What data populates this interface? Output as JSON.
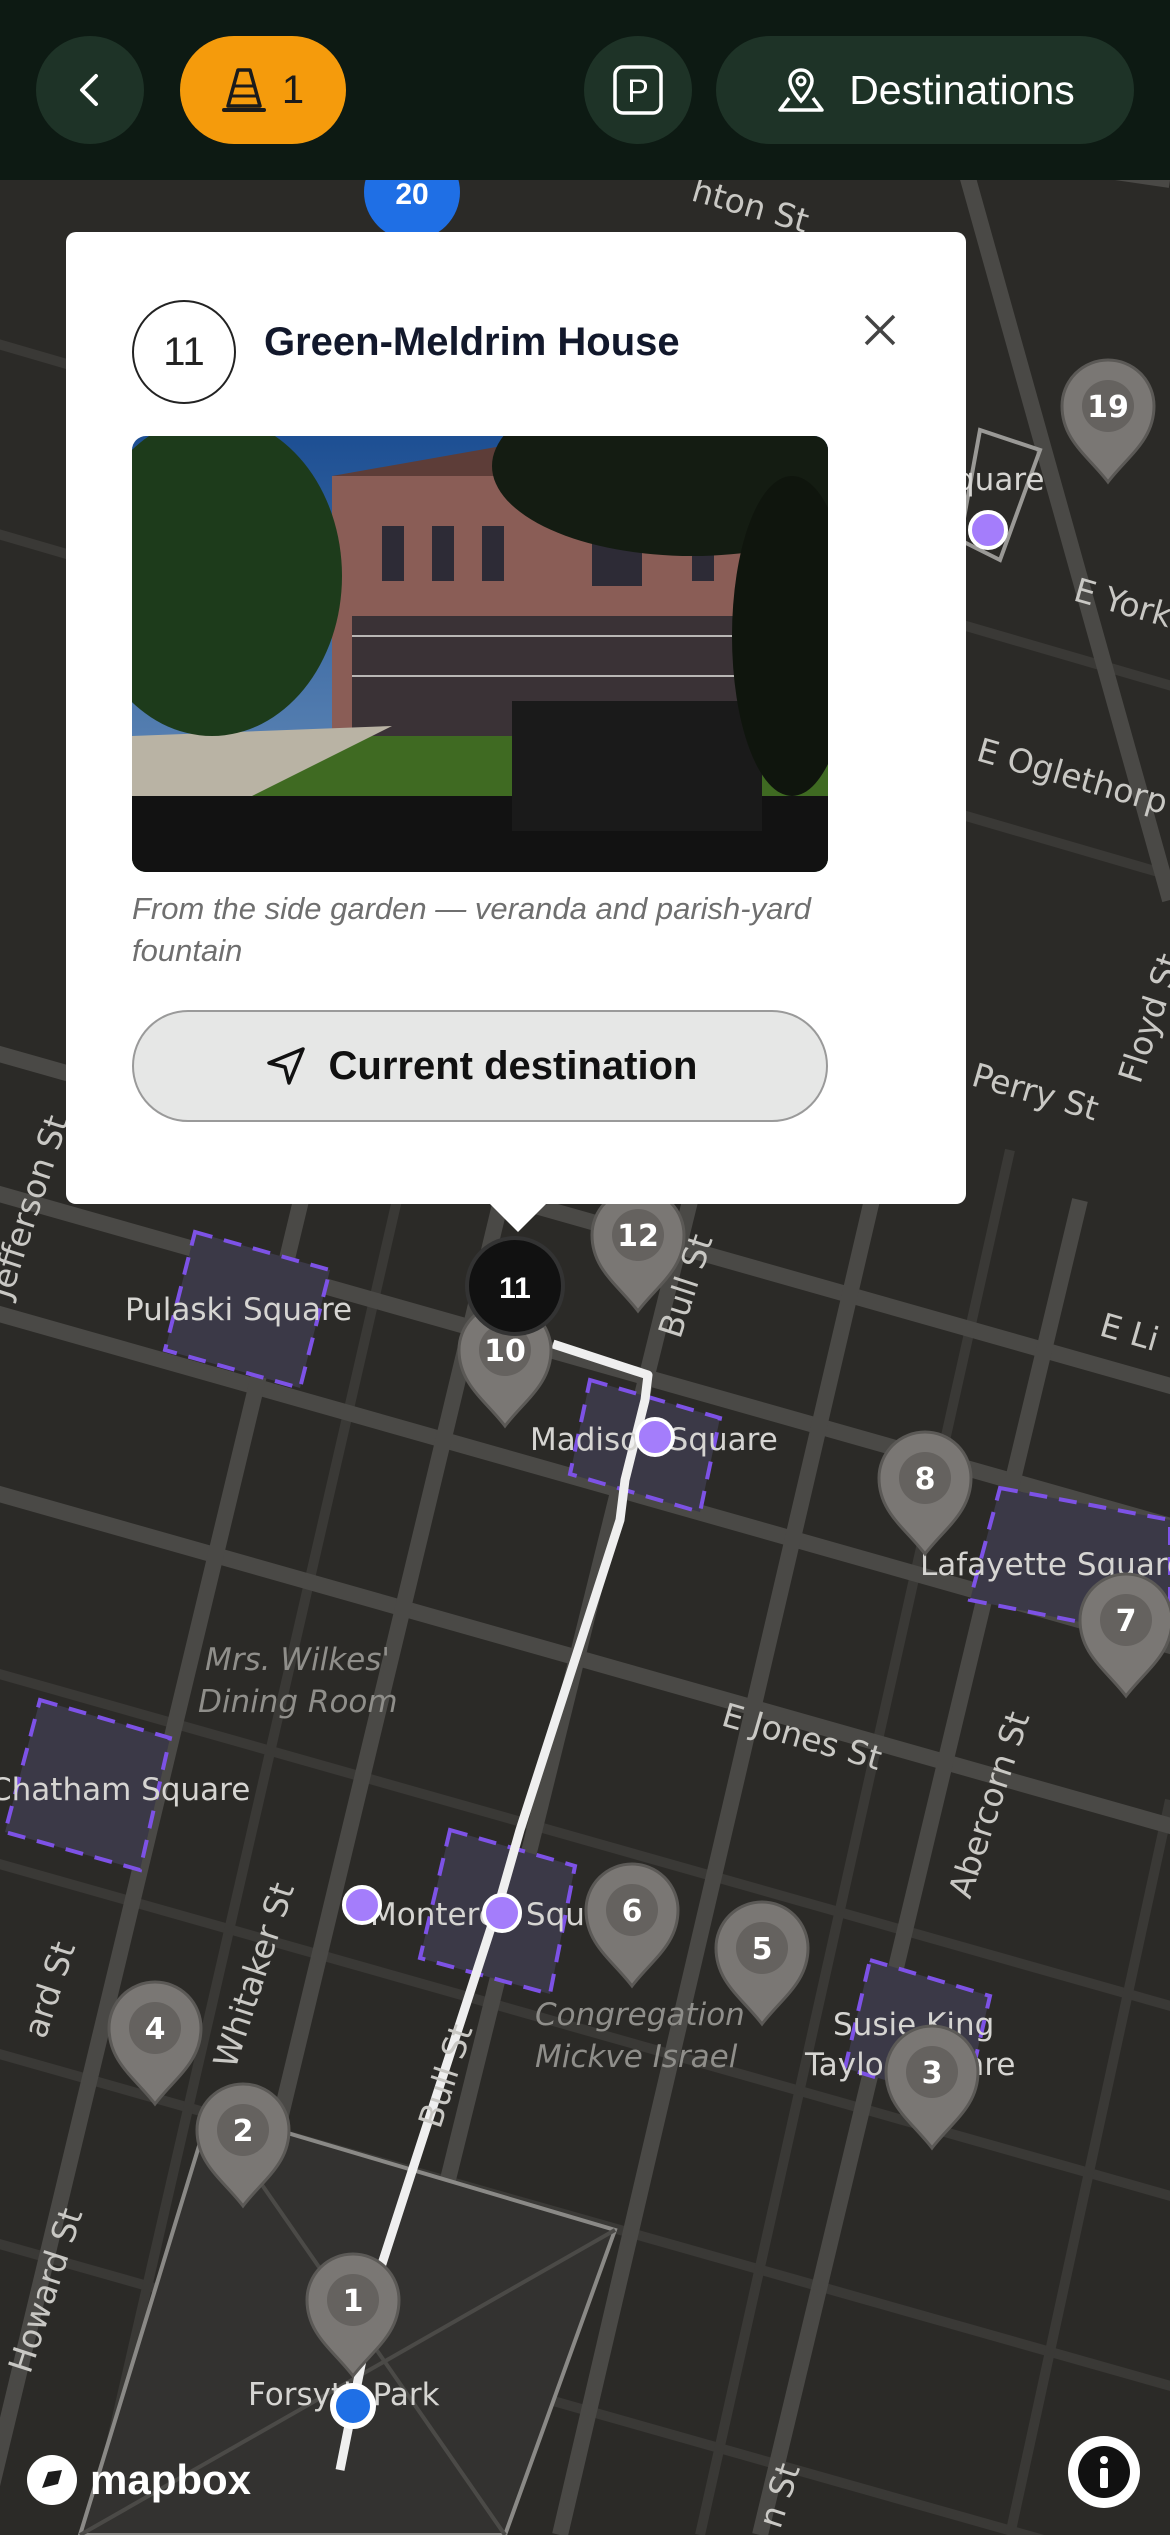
{
  "topbar": {
    "cone_count": "1",
    "destinations_label": "Destinations",
    "parking_label": "P"
  },
  "card": {
    "number": "11",
    "title": "Green-Meldrim House",
    "caption": "From the side garden — veranda and parish-yard fountain",
    "button_label": "Current destination"
  },
  "map": {
    "streets": [
      {
        "name": "Bull St"
      },
      {
        "name": "Whitaker St"
      },
      {
        "name": "Jefferson St"
      },
      {
        "name": "Howard St"
      },
      {
        "name": "Abercorn St"
      },
      {
        "name": "Perry St"
      },
      {
        "name": "Floyd St"
      },
      {
        "name": "E Jones St"
      },
      {
        "name": "E York"
      },
      {
        "name": "E Oglethorp"
      },
      {
        "name": "E Li"
      },
      {
        "name": "hton St"
      },
      {
        "name": "Bull St"
      },
      {
        "name": "ard St"
      },
      {
        "name": "n St"
      }
    ],
    "places": [
      {
        "name": "Pulaski Square"
      },
      {
        "name": "Madison Square"
      },
      {
        "name": "Lafayette Square"
      },
      {
        "name": "Chatham Square"
      },
      {
        "name": "Monterey Square"
      },
      {
        "name": "Susie King Taylor Square"
      },
      {
        "name": "Forsyth Park"
      },
      {
        "name": "quare"
      }
    ],
    "pois": [
      {
        "name": "Mrs. Wilkes' Dining Room"
      },
      {
        "name": "Congregation Mickve Israel"
      }
    ],
    "markers": [
      "1",
      "2",
      "3",
      "4",
      "5",
      "6",
      "7",
      "8",
      "10",
      "12",
      "19"
    ],
    "selected_marker": "11",
    "top_marker": "20",
    "attribution": "mapbox"
  }
}
